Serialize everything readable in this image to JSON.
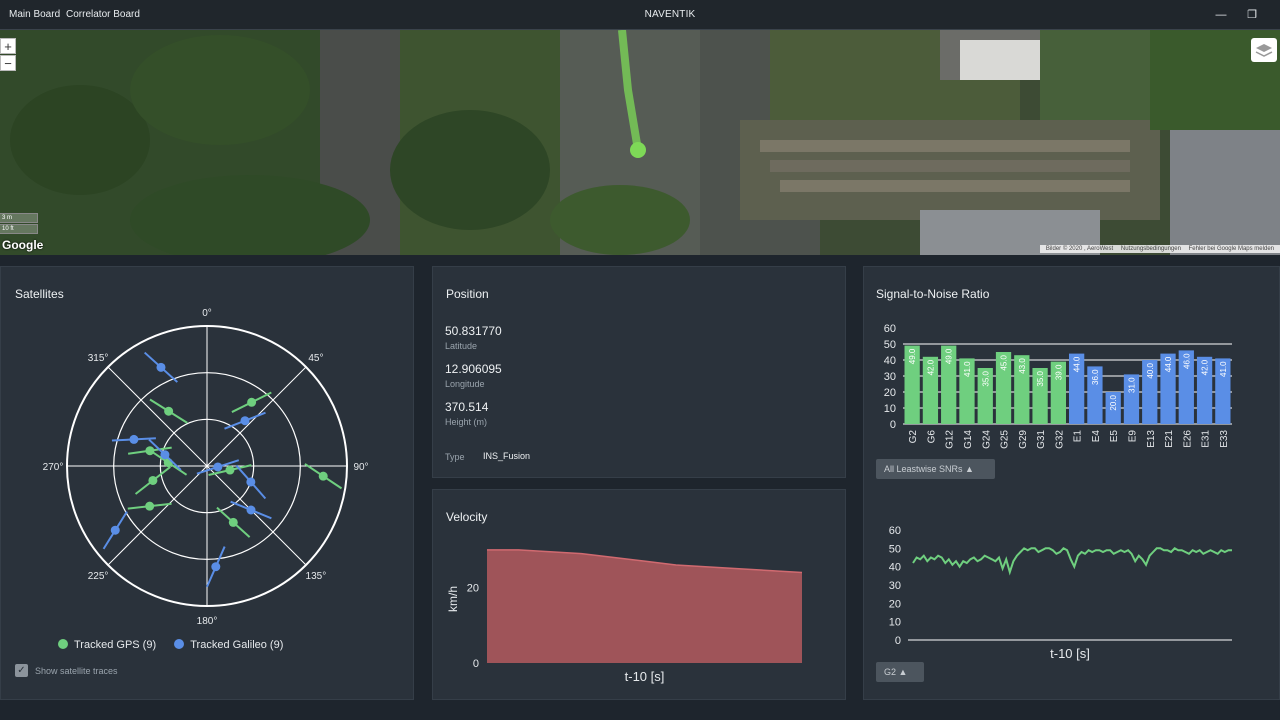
{
  "titlebar": {
    "nav": [
      "Main Board",
      "Correlator Board"
    ],
    "title": "NAVENTIK",
    "minimize_icon": "minimize-icon",
    "restore_icon": "restore-icon"
  },
  "map": {
    "zoom_in": "+",
    "zoom_out": "−",
    "logo": "Google",
    "scale_m": "3 m",
    "scale_ft": "10 ft",
    "attribution": [
      "Bilder © 2020 , AeroWest",
      "Nutzungsbedingungen",
      "Fehler bei Google Maps melden"
    ],
    "track_color": "#7ed957",
    "layers_icon": "layers-icon"
  },
  "satellites": {
    "title": "Satellites",
    "angle_labels": [
      "0°",
      "45°",
      "90°",
      "135°",
      "180°",
      "225°",
      "270°",
      "315°"
    ],
    "legend": [
      {
        "label": "Tracked GPS (9)",
        "color": "#6fcf7f"
      },
      {
        "label": "Tracked Galileo (9)",
        "color": "#5a8ee6"
      }
    ],
    "traces_label": "Show satellite traces",
    "traces_checked": true
  },
  "position": {
    "title": "Position",
    "latitude": "50.831770",
    "latitude_label": "Latitude",
    "longitude": "12.906095",
    "longitude_label": "Longitude",
    "height": "370.514",
    "height_label": "Height (m)",
    "type_label": "Type",
    "type_value": "INS_Fusion"
  },
  "velocity": {
    "title": "Velocity",
    "ylabel": "km/h",
    "xlabel": "t-10 [s]"
  },
  "snr": {
    "title": "Signal-to-Noise Ratio",
    "dropdown_label": "All Leastwise SNRs",
    "xlabel": "t-10 [s]",
    "sat_dropdown_label": "G2"
  },
  "chart_data": [
    {
      "type": "polar-scatter",
      "series": [
        {
          "name": "Tracked GPS (9)",
          "color": "#6fcf7f",
          "points": [
            {
              "az": 325,
              "el": 47
            },
            {
              "az": 35,
              "el": 40
            },
            {
              "az": 285,
              "el": 52
            },
            {
              "az": 275,
              "el": 65
            },
            {
              "az": 255,
              "el": 54
            },
            {
              "az": 235,
              "el": 45
            },
            {
              "az": 155,
              "el": 50
            },
            {
              "az": 95,
              "el": 15
            },
            {
              "az": 100,
              "el": 75
            }
          ]
        },
        {
          "name": "Tracked Galileo (9)",
          "color": "#5a8ee6",
          "points": [
            {
              "az": 335,
              "el": 20
            },
            {
              "az": 40,
              "el": 52
            },
            {
              "az": 290,
              "el": 40
            },
            {
              "az": 285,
              "el": 62
            },
            {
              "az": 235,
              "el": 18
            },
            {
              "az": 175,
              "el": 25
            },
            {
              "az": 135,
              "el": 50
            },
            {
              "az": 110,
              "el": 60
            },
            {
              "az": 95,
              "el": 83
            }
          ]
        }
      ]
    },
    {
      "type": "area",
      "color": "#b45a5f",
      "x": [
        0,
        1,
        2,
        3,
        4,
        5,
        6,
        7,
        8,
        9,
        10
      ],
      "values": [
        30,
        30,
        29.5,
        29,
        28,
        27,
        26,
        25.5,
        25,
        24.5,
        24
      ],
      "ylabel": "km/h",
      "xlabel": "t-10 [s]",
      "yticks": [
        0,
        20
      ],
      "ylim": [
        0,
        35
      ]
    },
    {
      "type": "bar",
      "categories": [
        "G2",
        "G6",
        "G12",
        "G14",
        "G24",
        "G25",
        "G29",
        "G31",
        "G32",
        "E1",
        "E4",
        "E5",
        "E9",
        "E13",
        "E21",
        "E26",
        "E31",
        "E33"
      ],
      "values": [
        49.0,
        42.0,
        49.0,
        41.0,
        35.0,
        45.0,
        43.0,
        35.0,
        39.0,
        44.0,
        36.0,
        20.0,
        31.0,
        40.0,
        44.0,
        46.0,
        42.0,
        41.0
      ],
      "colors": [
        "#6fcf7f",
        "#6fcf7f",
        "#6fcf7f",
        "#6fcf7f",
        "#6fcf7f",
        "#6fcf7f",
        "#6fcf7f",
        "#6fcf7f",
        "#6fcf7f",
        "#5a8ee6",
        "#5a8ee6",
        "#5a8ee6",
        "#5a8ee6",
        "#5a8ee6",
        "#5a8ee6",
        "#5a8ee6",
        "#5a8ee6",
        "#5a8ee6"
      ],
      "ylim": [
        0,
        60
      ],
      "yticks": [
        0,
        10,
        20,
        30,
        40,
        50,
        60
      ]
    },
    {
      "type": "line",
      "color": "#6fcf7f",
      "values": [
        42,
        45,
        44,
        46,
        43,
        45,
        44,
        46,
        45,
        42,
        44,
        41,
        43,
        40,
        43,
        42,
        44,
        45,
        43,
        44,
        46,
        45,
        44,
        43,
        45,
        39,
        44,
        37,
        43,
        46,
        48,
        50,
        49,
        50,
        50,
        48,
        49,
        50,
        50,
        49,
        47,
        48,
        50,
        49,
        44,
        40,
        46,
        48,
        47,
        49,
        48,
        49,
        49,
        48,
        49,
        49,
        47,
        48,
        49,
        48,
        49,
        47,
        43,
        46,
        44,
        41,
        46,
        48,
        50,
        50,
        49,
        49,
        48,
        50,
        49,
        49,
        48,
        47,
        49,
        48,
        49,
        47,
        48,
        49,
        48,
        47,
        49,
        48,
        49,
        49
      ],
      "xlabel": "t-10 [s]",
      "ylim": [
        0,
        60
      ],
      "yticks": [
        0,
        10,
        20,
        30,
        40,
        50,
        60
      ]
    }
  ]
}
